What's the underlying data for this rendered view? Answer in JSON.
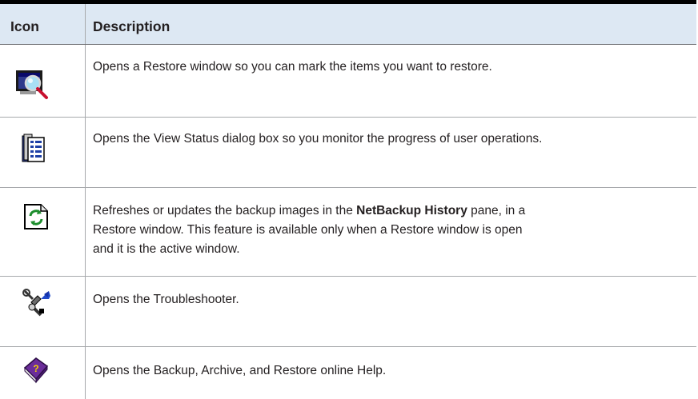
{
  "table": {
    "headers": {
      "icon": "Icon",
      "description": "Description"
    },
    "rows": [
      {
        "icon": "restore-window-magnifier-icon",
        "text": "Opens a Restore window so you can mark the items you want to restore."
      },
      {
        "icon": "view-status-icon",
        "text": "Opens the View Status dialog box so you monitor the progress of user operations."
      },
      {
        "icon": "refresh-icon",
        "line1_before": "Refreshes or updates the backup images in the ",
        "line1_bold": "NetBackup History",
        "line1_after": " pane, in a",
        "line2": "Restore window. This feature is available only when a Restore window is open",
        "line3": "and it is the active window."
      },
      {
        "icon": "troubleshooter-icon",
        "text": "Opens the Troubleshooter."
      },
      {
        "icon": "online-help-book-icon",
        "text": "Opens the Backup, Archive, and Restore online Help."
      }
    ]
  },
  "colors": {
    "header_bg": "#dde8f3",
    "rule": "#a7a9ac",
    "text": "#231f20",
    "top_rule": "#000000"
  }
}
